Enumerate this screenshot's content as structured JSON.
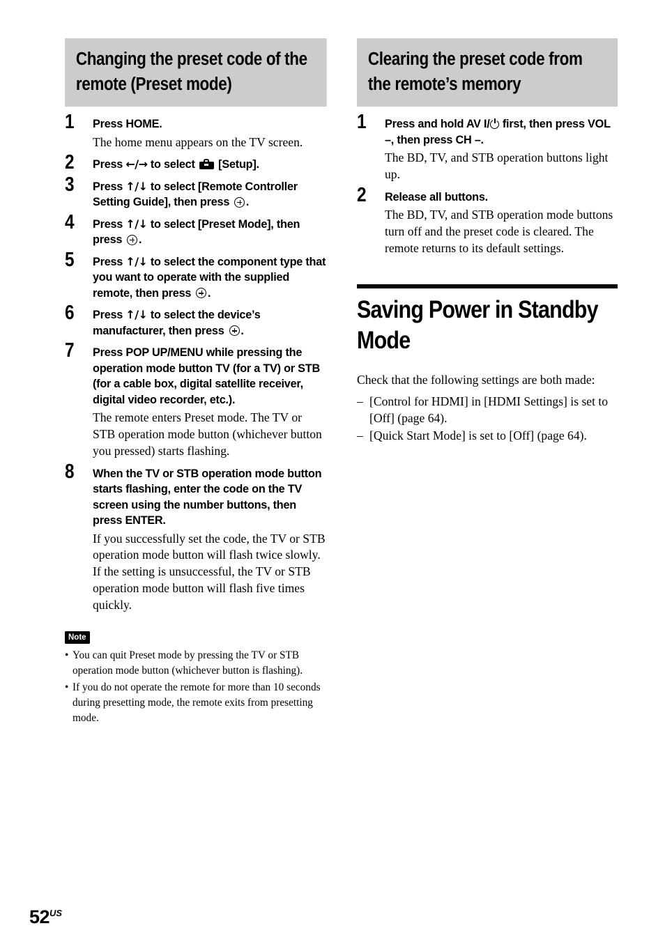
{
  "page": {
    "number": "52",
    "region_suffix": "US"
  },
  "left_column": {
    "heading": "Changing the preset code of the remote (Preset mode)",
    "steps": [
      {
        "number": "1",
        "title_parts": [
          {
            "type": "text",
            "value": "Press HOME."
          }
        ],
        "body": "The home menu appears on the TV screen."
      },
      {
        "number": "2",
        "title_parts": [
          {
            "type": "text",
            "value": "Press "
          },
          {
            "type": "arrows",
            "value": "←/→"
          },
          {
            "type": "text",
            "value": " to select "
          },
          {
            "type": "icon",
            "value": "toolbox-icon"
          },
          {
            "type": "text",
            "value": " [Setup]."
          }
        ],
        "body": ""
      },
      {
        "number": "3",
        "title_parts": [
          {
            "type": "text",
            "value": "Press "
          },
          {
            "type": "arrows",
            "value": "↑/↓"
          },
          {
            "type": "text",
            "value": " to select [Remote Controller Setting Guide], then press "
          },
          {
            "type": "icon",
            "value": "enter-icon"
          },
          {
            "type": "text",
            "value": "."
          }
        ],
        "body": ""
      },
      {
        "number": "4",
        "title_parts": [
          {
            "type": "text",
            "value": "Press "
          },
          {
            "type": "arrows",
            "value": "↑/↓"
          },
          {
            "type": "text",
            "value": " to select [Preset Mode], then press "
          },
          {
            "type": "icon",
            "value": "enter-icon"
          },
          {
            "type": "text",
            "value": "."
          }
        ],
        "body": ""
      },
      {
        "number": "5",
        "title_parts": [
          {
            "type": "text",
            "value": "Press "
          },
          {
            "type": "arrows",
            "value": "↑/↓"
          },
          {
            "type": "text",
            "value": " to select the component type that you want to operate with the supplied remote, then press "
          },
          {
            "type": "icon",
            "value": "enter-icon"
          },
          {
            "type": "text",
            "value": "."
          }
        ],
        "body": ""
      },
      {
        "number": "6",
        "title_parts": [
          {
            "type": "text",
            "value": "Press "
          },
          {
            "type": "arrows",
            "value": "↑/↓"
          },
          {
            "type": "text",
            "value": " to select the device’s manufacturer, then press "
          },
          {
            "type": "icon",
            "value": "enter-icon"
          },
          {
            "type": "text",
            "value": "."
          }
        ],
        "body": ""
      },
      {
        "number": "7",
        "title_parts": [
          {
            "type": "text",
            "value": "Press POP UP/MENU while pressing the operation mode button TV (for a TV) or STB (for a cable box, digital satellite receiver, digital video recorder, etc.)."
          }
        ],
        "body": "The remote enters Preset mode. The TV or STB operation mode button (whichever button you pressed) starts flashing."
      },
      {
        "number": "8",
        "title_parts": [
          {
            "type": "text",
            "value": "When the TV or STB operation mode button starts flashing, enter the code on the TV screen using the number buttons, then press ENTER."
          }
        ],
        "body": "If you successfully set the code, the TV or STB operation mode button will flash twice slowly. If the setting is unsuccessful, the TV or STB operation mode button will flash five times quickly."
      }
    ],
    "note": {
      "label": "Note",
      "bullet_char": "•",
      "items": [
        "You can quit Preset mode by pressing the TV or STB operation mode button (whichever button is flashing).",
        "If you do not operate the remote for more than 10 seconds during presetting mode, the remote exits from presetting mode."
      ]
    }
  },
  "right_column": {
    "heading": "Clearing the preset code from the remote’s memory",
    "steps": [
      {
        "number": "1",
        "title_parts": [
          {
            "type": "text",
            "value": "Press and hold AV I/"
          },
          {
            "type": "icon",
            "value": "power-icon"
          },
          {
            "type": "text",
            "value": " first, then press VOL –, then press CH –."
          }
        ],
        "body": "The BD, TV, and STB operation buttons light up."
      },
      {
        "number": "2",
        "title_parts": [
          {
            "type": "text",
            "value": "Release all buttons."
          }
        ],
        "body": "The BD, TV, and STB operation mode buttons turn off and the preset code is cleared. The remote returns to its default settings."
      }
    ],
    "main_section": {
      "heading": "Saving Power in Standby Mode",
      "lead": "Check that the following settings are both made:",
      "dash_char": "–",
      "items": [
        "[Control for HDMI] in [HDMI Settings] is set to [Off] (page 64).",
        "[Quick Start Mode] is set to [Off] (page 64)."
      ]
    }
  },
  "colors": {
    "heading_background": "#cccccc",
    "rule": "#000000",
    "text": "#000000",
    "note_badge_background": "#000000",
    "note_badge_text": "#ffffff"
  }
}
